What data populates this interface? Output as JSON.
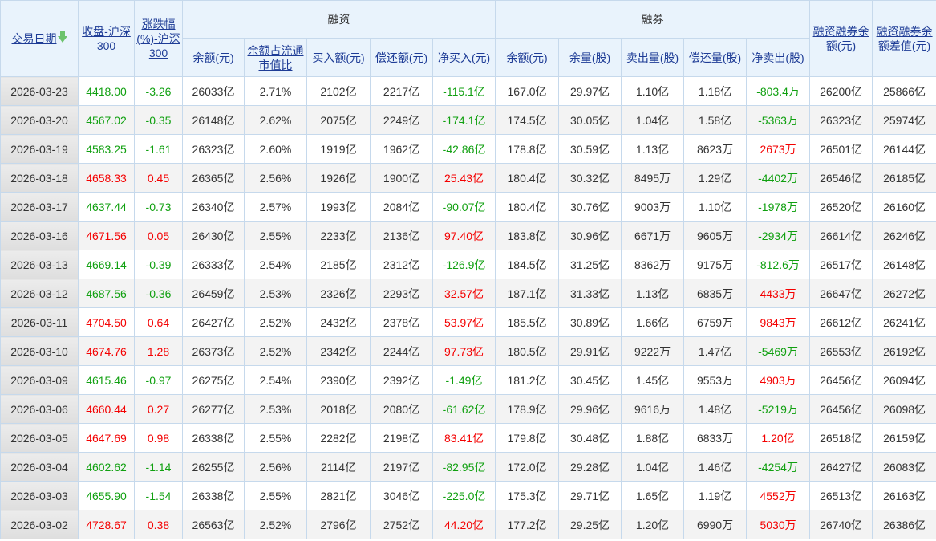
{
  "headers": {
    "date": "交易日期",
    "close": "收盘-沪深300",
    "change": "涨跌幅(%)-沪深300",
    "margin_group": "融资",
    "short_group": "融券",
    "margin": [
      "余额(元)",
      "余额占流通市值比",
      "买入额(元)",
      "偿还额(元)",
      "净买入(元)"
    ],
    "short": [
      "余额(元)",
      "余量(股)",
      "卖出量(股)",
      "偿还量(股)",
      "净卖出(股)"
    ],
    "total": "融资融券余额(元)",
    "diff": "融资融券余额差值(元)"
  },
  "sort_icon": "arrow-down-icon",
  "colors": {
    "up": "#f40000",
    "down": "#10a010",
    "link": "#1e3c96",
    "header_bg": "#e9f3fc"
  },
  "rows": [
    [
      "2026-03-23",
      "4418.00",
      "-3.26",
      "26033亿",
      "2.71%",
      "2102亿",
      "2217亿",
      "-115.1亿",
      "167.0亿",
      "29.97亿",
      "1.10亿",
      "1.18亿",
      "-803.4万",
      "26200亿",
      "25866亿"
    ],
    [
      "2026-03-20",
      "4567.02",
      "-0.35",
      "26148亿",
      "2.62%",
      "2075亿",
      "2249亿",
      "-174.1亿",
      "174.5亿",
      "30.05亿",
      "1.04亿",
      "1.58亿",
      "-5363万",
      "26323亿",
      "25974亿"
    ],
    [
      "2026-03-19",
      "4583.25",
      "-1.61",
      "26323亿",
      "2.60%",
      "1919亿",
      "1962亿",
      "-42.86亿",
      "178.8亿",
      "30.59亿",
      "1.13亿",
      "8623万",
      "2673万",
      "26501亿",
      "26144亿"
    ],
    [
      "2026-03-18",
      "4658.33",
      "0.45",
      "26365亿",
      "2.56%",
      "1926亿",
      "1900亿",
      "25.43亿",
      "180.4亿",
      "30.32亿",
      "8495万",
      "1.29亿",
      "-4402万",
      "26546亿",
      "26185亿"
    ],
    [
      "2026-03-17",
      "4637.44",
      "-0.73",
      "26340亿",
      "2.57%",
      "1993亿",
      "2084亿",
      "-90.07亿",
      "180.4亿",
      "30.76亿",
      "9003万",
      "1.10亿",
      "-1978万",
      "26520亿",
      "26160亿"
    ],
    [
      "2026-03-16",
      "4671.56",
      "0.05",
      "26430亿",
      "2.55%",
      "2233亿",
      "2136亿",
      "97.40亿",
      "183.8亿",
      "30.96亿",
      "6671万",
      "9605万",
      "-2934万",
      "26614亿",
      "26246亿"
    ],
    [
      "2026-03-13",
      "4669.14",
      "-0.39",
      "26333亿",
      "2.54%",
      "2185亿",
      "2312亿",
      "-126.9亿",
      "184.5亿",
      "31.25亿",
      "8362万",
      "9175万",
      "-812.6万",
      "26517亿",
      "26148亿"
    ],
    [
      "2026-03-12",
      "4687.56",
      "-0.36",
      "26459亿",
      "2.53%",
      "2326亿",
      "2293亿",
      "32.57亿",
      "187.1亿",
      "31.33亿",
      "1.13亿",
      "6835万",
      "4433万",
      "26647亿",
      "26272亿"
    ],
    [
      "2026-03-11",
      "4704.50",
      "0.64",
      "26427亿",
      "2.52%",
      "2432亿",
      "2378亿",
      "53.97亿",
      "185.5亿",
      "30.89亿",
      "1.66亿",
      "6759万",
      "9843万",
      "26612亿",
      "26241亿"
    ],
    [
      "2026-03-10",
      "4674.76",
      "1.28",
      "26373亿",
      "2.52%",
      "2342亿",
      "2244亿",
      "97.73亿",
      "180.5亿",
      "29.91亿",
      "9222万",
      "1.47亿",
      "-5469万",
      "26553亿",
      "26192亿"
    ],
    [
      "2026-03-09",
      "4615.46",
      "-0.97",
      "26275亿",
      "2.54%",
      "2390亿",
      "2392亿",
      "-1.49亿",
      "181.2亿",
      "30.45亿",
      "1.45亿",
      "9553万",
      "4903万",
      "26456亿",
      "26094亿"
    ],
    [
      "2026-03-06",
      "4660.44",
      "0.27",
      "26277亿",
      "2.53%",
      "2018亿",
      "2080亿",
      "-61.62亿",
      "178.9亿",
      "29.96亿",
      "9616万",
      "1.48亿",
      "-5219万",
      "26456亿",
      "26098亿"
    ],
    [
      "2026-03-05",
      "4647.69",
      "0.98",
      "26338亿",
      "2.55%",
      "2282亿",
      "2198亿",
      "83.41亿",
      "179.8亿",
      "30.48亿",
      "1.88亿",
      "6833万",
      "1.20亿",
      "26518亿",
      "26159亿"
    ],
    [
      "2026-03-04",
      "4602.62",
      "-1.14",
      "26255亿",
      "2.56%",
      "2114亿",
      "2197亿",
      "-82.95亿",
      "172.0亿",
      "29.28亿",
      "1.04亿",
      "1.46亿",
      "-4254万",
      "26427亿",
      "26083亿"
    ],
    [
      "2026-03-03",
      "4655.90",
      "-1.54",
      "26338亿",
      "2.55%",
      "2821亿",
      "3046亿",
      "-225.0亿",
      "175.3亿",
      "29.71亿",
      "1.65亿",
      "1.19亿",
      "4552万",
      "26513亿",
      "26163亿"
    ],
    [
      "2026-03-02",
      "4728.67",
      "0.38",
      "26563亿",
      "2.52%",
      "2796亿",
      "2752亿",
      "44.20亿",
      "177.2亿",
      "29.25亿",
      "1.20亿",
      "6990万",
      "5030万",
      "26740亿",
      "26386亿"
    ]
  ]
}
